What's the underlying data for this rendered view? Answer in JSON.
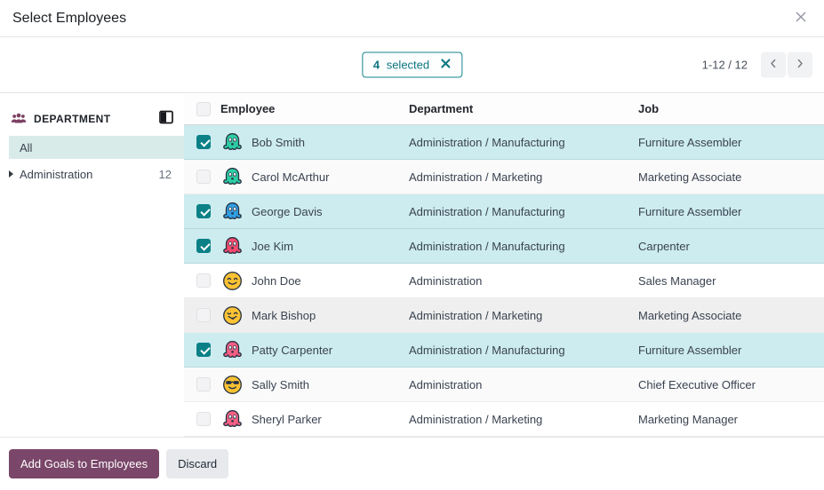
{
  "dialog": {
    "title": "Select Employees"
  },
  "control_panel": {
    "selection_badge": {
      "count": "4",
      "label": "selected"
    },
    "pager": {
      "range": "1-12 / 12"
    }
  },
  "sidebar": {
    "section_title": "DEPARTMENT",
    "items": [
      {
        "label": "All",
        "count": "",
        "selected": true,
        "expandable": false
      },
      {
        "label": "Administration",
        "count": "12",
        "selected": false,
        "expandable": true
      }
    ]
  },
  "table": {
    "columns": [
      "Employee",
      "Department",
      "Job"
    ],
    "rows": [
      {
        "name": "Bob Smith",
        "department": "Administration / Manufacturing",
        "job": "Furniture Assembler",
        "checked": true,
        "selected": true,
        "hovered": false,
        "avatar": {
          "type": "ghost",
          "color": "#2bcfa4"
        }
      },
      {
        "name": "Carol McArthur",
        "department": "Administration / Marketing",
        "job": "Marketing Associate",
        "checked": false,
        "selected": false,
        "hovered": false,
        "avatar": {
          "type": "ghost",
          "color": "#2bcfa4"
        }
      },
      {
        "name": "George Davis",
        "department": "Administration / Manufacturing",
        "job": "Furniture Assembler",
        "checked": true,
        "selected": true,
        "hovered": false,
        "avatar": {
          "type": "ghost",
          "color": "#2f9fe4"
        }
      },
      {
        "name": "Joe Kim",
        "department": "Administration / Manufacturing",
        "job": "Carpenter",
        "checked": true,
        "selected": true,
        "hovered": false,
        "avatar": {
          "type": "ghost",
          "color": "#f74a6e"
        }
      },
      {
        "name": "John Doe",
        "department": "Administration",
        "job": "Sales Manager",
        "checked": false,
        "selected": false,
        "hovered": false,
        "avatar": {
          "type": "face-smile",
          "color": "#fcc233"
        }
      },
      {
        "name": "Mark Bishop",
        "department": "Administration / Marketing",
        "job": "Marketing Associate",
        "checked": false,
        "selected": false,
        "hovered": true,
        "avatar": {
          "type": "face-tongue",
          "color": "#fcc233"
        }
      },
      {
        "name": "Patty Carpenter",
        "department": "Administration / Manufacturing",
        "job": "Furniture Assembler",
        "checked": true,
        "selected": true,
        "hovered": false,
        "avatar": {
          "type": "ghost",
          "color": "#f75f83"
        }
      },
      {
        "name": "Sally Smith",
        "department": "Administration",
        "job": "Chief Executive Officer",
        "checked": false,
        "selected": false,
        "hovered": false,
        "avatar": {
          "type": "face-sunglasses",
          "color": "#fcc233"
        }
      },
      {
        "name": "Sheryl Parker",
        "department": "Administration / Marketing",
        "job": "Marketing Manager",
        "checked": false,
        "selected": false,
        "hovered": false,
        "avatar": {
          "type": "ghost",
          "color": "#f75f83"
        }
      }
    ]
  },
  "footer": {
    "primary_label": "Add Goals to Employees",
    "secondary_label": "Discard"
  },
  "colors": {
    "accent_teal": "#0d7680",
    "selected_row_bg": "#cdecef",
    "primary_button_bg": "#7a4669",
    "sidebar_icon_purple": "#7c3f63"
  }
}
